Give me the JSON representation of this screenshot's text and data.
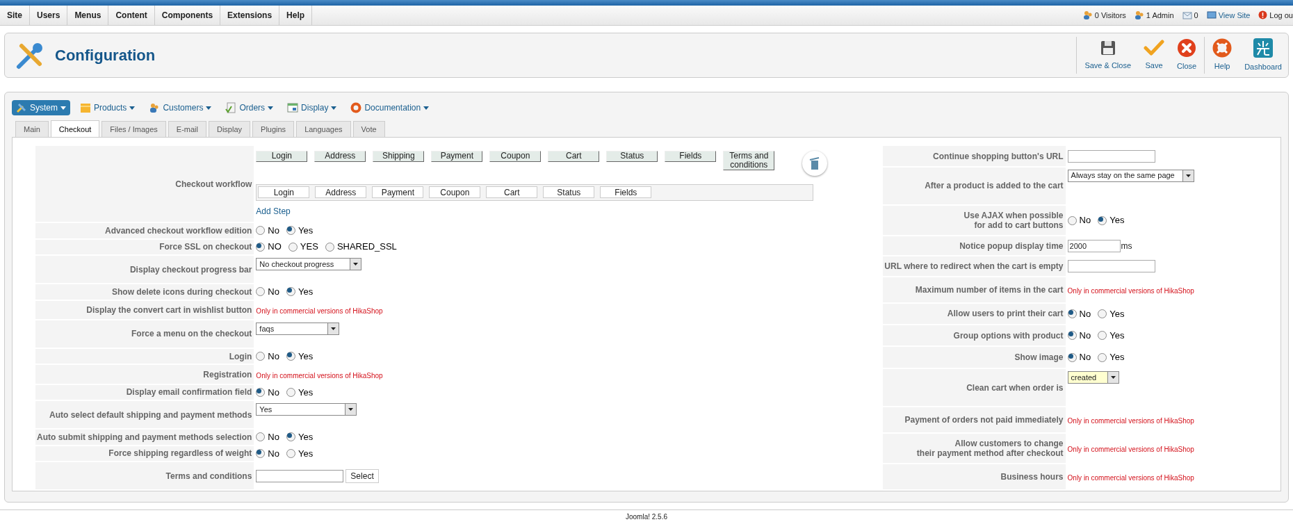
{
  "menu_bar": {
    "items": [
      "Site",
      "Users",
      "Menus",
      "Content",
      "Components",
      "Extensions",
      "Help"
    ],
    "status": [
      {
        "kind": "visitors",
        "label": "0 Visitors"
      },
      {
        "kind": "admins",
        "label": "1 Admin"
      },
      {
        "kind": "messages",
        "label": "0"
      },
      {
        "kind": "site",
        "label": "View Site"
      },
      {
        "kind": "logout",
        "label": "Log ou"
      }
    ]
  },
  "header": {
    "title": "Configuration",
    "toolbar": [
      {
        "kind": "save_close",
        "label": "Save & Close"
      },
      {
        "kind": "save",
        "label": "Save"
      },
      {
        "kind": "close",
        "label": "Close"
      },
      {
        "kind": "help",
        "label": "Help"
      },
      {
        "kind": "dashboard",
        "label": "Dashboard"
      }
    ]
  },
  "submenu": [
    {
      "kind": "system",
      "label": "System",
      "selected": true
    },
    {
      "kind": "products",
      "label": "Products",
      "selected": false
    },
    {
      "kind": "customers",
      "label": "Customers",
      "selected": false
    },
    {
      "kind": "orders",
      "label": "Orders",
      "selected": false
    },
    {
      "kind": "display",
      "label": "Display",
      "selected": false
    },
    {
      "kind": "documentation",
      "label": "Documentation",
      "selected": false
    }
  ],
  "tabs": [
    {
      "label": "Main",
      "selected": false
    },
    {
      "label": "Checkout",
      "selected": true
    },
    {
      "label": "Files / Images",
      "selected": false
    },
    {
      "label": "E-mail",
      "selected": false
    },
    {
      "label": "Display",
      "selected": false
    },
    {
      "label": "Plugins",
      "selected": false
    },
    {
      "label": "Languages",
      "selected": false
    },
    {
      "label": "Vote",
      "selected": false
    }
  ],
  "left_settings": [
    {
      "kind": "workflow",
      "label": "Checkout workflow",
      "available_steps": [
        "Login",
        "Address",
        "Shipping",
        "Payment",
        "Coupon",
        "Cart",
        "Status",
        "Fields",
        "Terms and conditions"
      ],
      "workflow_steps": [
        "Login",
        "Address",
        "Payment",
        "Coupon",
        "Cart",
        "Status",
        "Fields"
      ],
      "add_link": "Add Step"
    },
    {
      "kind": "radio",
      "label": "Advanced checkout workflow edition",
      "options": [
        {
          "label": "No",
          "selected": false
        },
        {
          "label": "Yes",
          "selected": true
        }
      ]
    },
    {
      "kind": "radio",
      "label": "Force SSL on checkout",
      "options": [
        {
          "label": "NO",
          "selected": true
        },
        {
          "label": "YES",
          "selected": false
        },
        {
          "label": "SHARED_SSL",
          "selected": false
        }
      ]
    },
    {
      "kind": "select",
      "label": "Display checkout progress bar",
      "value": "No checkout progress"
    },
    {
      "kind": "radio",
      "label": "Show delete icons during checkout",
      "options": [
        {
          "label": "No",
          "selected": false
        },
        {
          "label": "Yes",
          "selected": true
        }
      ]
    },
    {
      "kind": "commercial",
      "label": "Display the convert cart in wishlist button",
      "value": "Only in commercial versions of HikaShop"
    },
    {
      "kind": "select",
      "label": "Force a menu on the checkout",
      "value": "faqs"
    },
    {
      "kind": "radio",
      "label": "Login",
      "options": [
        {
          "label": "No",
          "selected": false
        },
        {
          "label": "Yes",
          "selected": true
        }
      ]
    },
    {
      "kind": "commercial",
      "label": "Registration",
      "value": "Only in commercial versions of HikaShop"
    },
    {
      "kind": "radio",
      "label": "Display email confirmation field",
      "options": [
        {
          "label": "No",
          "selected": true
        },
        {
          "label": "Yes",
          "selected": false
        }
      ]
    },
    {
      "kind": "select",
      "label": "Auto select default shipping and payment methods",
      "value": "Yes"
    },
    {
      "kind": "radio",
      "label": "Auto submit shipping and payment methods selection",
      "options": [
        {
          "label": "No",
          "selected": false
        },
        {
          "label": "Yes",
          "selected": true
        }
      ]
    },
    {
      "kind": "radio",
      "label": "Force shipping regardless of weight",
      "options": [
        {
          "label": "No",
          "selected": true
        },
        {
          "label": "Yes",
          "selected": false
        }
      ]
    },
    {
      "kind": "text_select",
      "label": "Terms and conditions",
      "button": "Select"
    }
  ],
  "right_settings": [
    {
      "kind": "text",
      "label": "Continue shopping button's URL"
    },
    {
      "kind": "select",
      "label": "After a product is added to the cart",
      "value": "Always stay on the same page"
    },
    {
      "kind": "radio",
      "label": "Use AJAX when possible\nfor add to cart buttons",
      "options": [
        {
          "label": "No",
          "selected": false
        },
        {
          "label": "Yes",
          "selected": true
        }
      ]
    },
    {
      "kind": "text",
      "label": "Notice popup display time",
      "value": "2000",
      "unit": "ms"
    },
    {
      "kind": "text",
      "label": "URL where to redirect when the cart is empty"
    },
    {
      "kind": "commercial",
      "label": "Maximum number of items in the cart",
      "value": "Only in commercial versions of HikaShop"
    },
    {
      "kind": "radio",
      "label": "Allow users to print their cart",
      "options": [
        {
          "label": "No",
          "selected": true
        },
        {
          "label": "Yes",
          "selected": false
        }
      ]
    },
    {
      "kind": "radio",
      "label": "Group options with product",
      "options": [
        {
          "label": "No",
          "selected": true
        },
        {
          "label": "Yes",
          "selected": false
        }
      ]
    },
    {
      "kind": "radio",
      "label": "Show image",
      "options": [
        {
          "label": "No",
          "selected": true
        },
        {
          "label": "Yes",
          "selected": false
        }
      ]
    },
    {
      "kind": "select",
      "label": "Clean cart when order is",
      "value": "created",
      "highlight": true
    },
    {
      "kind": "commercial",
      "label": "Payment of orders not paid immediately",
      "value": "Only in commercial versions of HikaShop"
    },
    {
      "kind": "commercial",
      "label": "Allow customers to change\ntheir payment method after checkout",
      "value": "Only in commercial versions of HikaShop"
    },
    {
      "kind": "commercial",
      "label": "Business hours",
      "value": "Only in commercial versions of HikaShop"
    }
  ],
  "footer": "Joomla! 2.5.6"
}
